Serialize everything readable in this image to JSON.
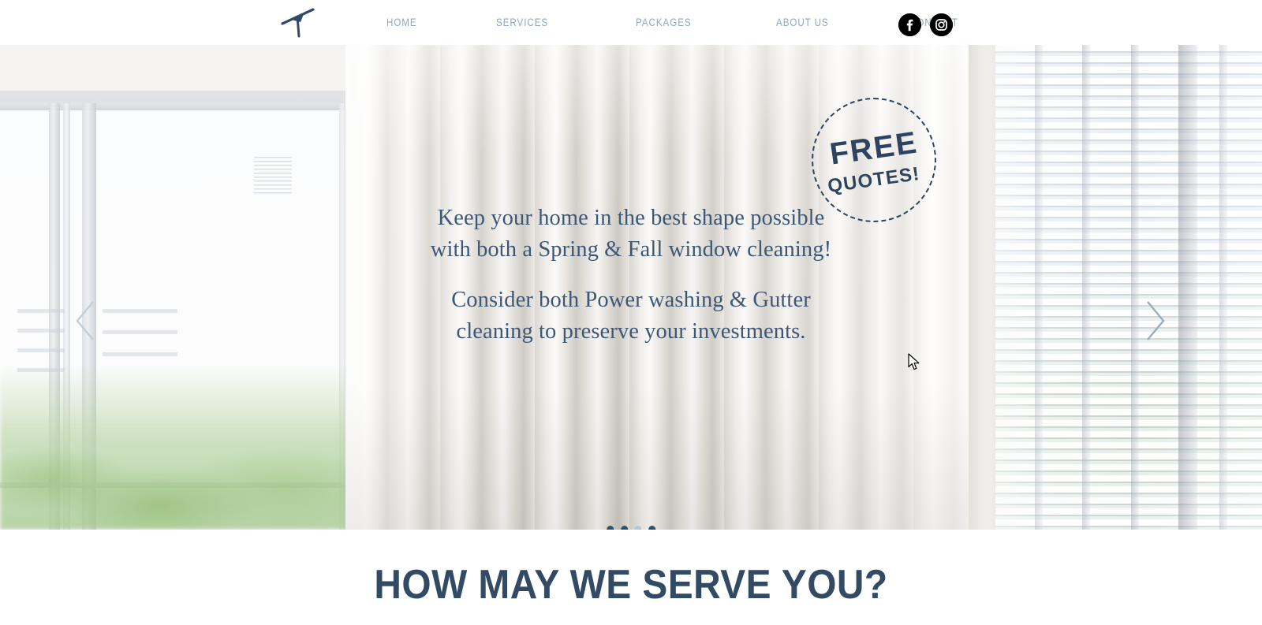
{
  "site": {
    "logo_icon": "squeegee-logo-icon",
    "accent_navy": "#2d4360",
    "nav_link_color": "#8fa6bd",
    "hero_text_color": "#3c5876",
    "heading_color": "#324a63"
  },
  "header": {
    "nav_items": [
      {
        "label": "HOME",
        "name": "nav-item-home"
      },
      {
        "label": "SERVICES",
        "name": "nav-item-services"
      },
      {
        "label": "PACKAGES",
        "name": "nav-item-packages"
      },
      {
        "label": "ABOUT US",
        "name": "nav-item-about-us"
      },
      {
        "label": "CONTACT",
        "name": "nav-item-contact"
      }
    ],
    "social": [
      {
        "name": "facebook-icon",
        "glyph": "f"
      },
      {
        "name": "instagram-icon",
        "glyph": "▣"
      }
    ]
  },
  "hero": {
    "badge": {
      "line1": "FREE",
      "line2": "QUOTES!"
    },
    "paragraph1_line1": "Keep your home in the best shape possible",
    "paragraph1_line2": "with both a Spring & Fall window cleaning!",
    "paragraph2_line1": "Consider both Power washing & Gutter",
    "paragraph2_line2": "cleaning to preserve your investments.",
    "prev_arrow": "slider-prev-arrow",
    "next_arrow": "slider-next-arrow",
    "dots": [
      {
        "active": true
      },
      {
        "active": true
      },
      {
        "active": false
      },
      {
        "active": true
      }
    ]
  },
  "section": {
    "title": "HOW MAY WE SERVE YOU?"
  }
}
